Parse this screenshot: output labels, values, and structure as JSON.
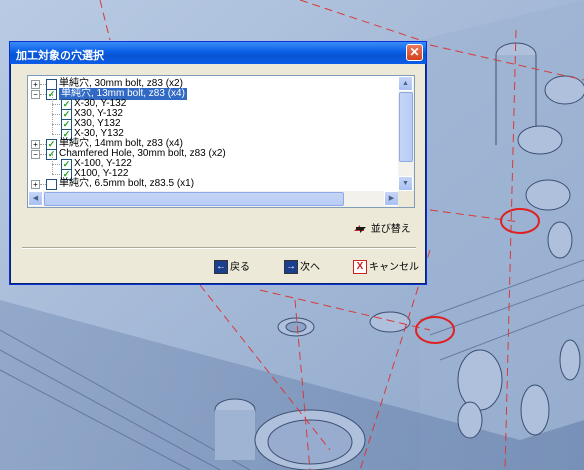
{
  "dialog": {
    "title": "加工対象の穴選択",
    "close_glyph": "✕"
  },
  "tree": [
    {
      "label": "単純穴, 30mm bolt, z83 (x2)",
      "checked": false,
      "expanded": false,
      "level": 0,
      "selected": false
    },
    {
      "label": "単純穴, 13mm bolt, z83 (x4)",
      "checked": true,
      "expanded": true,
      "level": 0,
      "selected": true
    },
    {
      "label": "X-30, Y-132",
      "checked": true,
      "level": 1
    },
    {
      "label": "X30, Y-132",
      "checked": true,
      "level": 1
    },
    {
      "label": "X30, Y132",
      "checked": true,
      "level": 1
    },
    {
      "label": "X-30, Y132",
      "checked": true,
      "level": 1
    },
    {
      "label": "単純穴, 14mm bolt, z83 (x4)",
      "checked": true,
      "expanded": false,
      "level": 0,
      "selected": false
    },
    {
      "label": "Chamfered Hole, 30mm bolt, z83 (x2)",
      "checked": true,
      "expanded": true,
      "level": 0,
      "selected": false
    },
    {
      "label": "X-100, Y-122",
      "checked": true,
      "level": 1
    },
    {
      "label": "X100, Y-122",
      "checked": true,
      "level": 1
    },
    {
      "label": "単純穴, 6.5mm bolt, z83.5 (x1)",
      "checked": false,
      "expanded": false,
      "level": 0,
      "selected": false
    }
  ],
  "buttons": {
    "sort": "並び替え",
    "back": "戻る",
    "next": "次へ",
    "cancel": "キャンセル"
  },
  "colors": {
    "title_bar": "#0a5fe6",
    "selection": "#316ac5",
    "check": "#21a121",
    "highlight_circle": "#e02020"
  }
}
